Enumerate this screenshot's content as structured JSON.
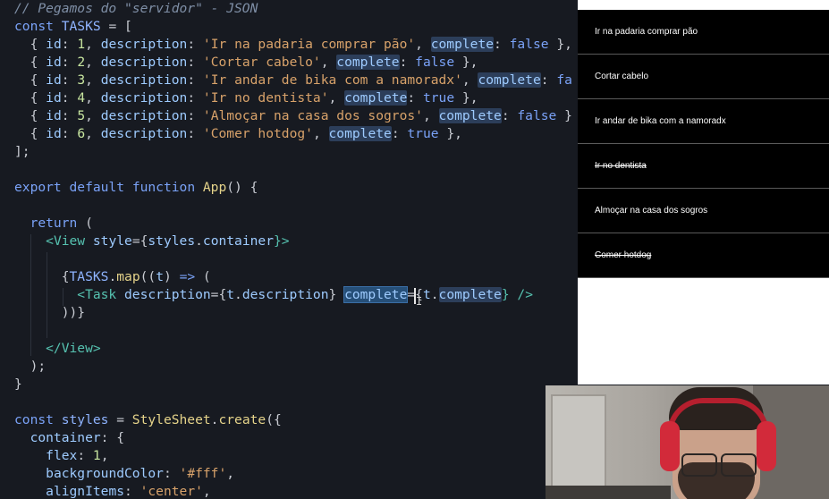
{
  "editor": {
    "lines": [
      [
        [
          "// Pegamos do \"servidor\" - JSON",
          "comment"
        ]
      ],
      [
        [
          "const ",
          "keyword"
        ],
        [
          "TASKS",
          "const"
        ],
        [
          " = [",
          "punct"
        ]
      ],
      [
        [
          "  { ",
          "punct"
        ],
        [
          "id",
          "prop"
        ],
        [
          ": ",
          "punct"
        ],
        [
          "1",
          "num"
        ],
        [
          ", ",
          "punct"
        ],
        [
          "description",
          "prop"
        ],
        [
          ": ",
          "punct"
        ],
        [
          "'Ir na padaria comprar pão'",
          "string"
        ],
        [
          ", ",
          "punct"
        ],
        [
          "complete",
          "hl"
        ],
        [
          ": ",
          "punct"
        ],
        [
          "false",
          "bool"
        ],
        [
          " },",
          "punct"
        ]
      ],
      [
        [
          "  { ",
          "punct"
        ],
        [
          "id",
          "prop"
        ],
        [
          ": ",
          "punct"
        ],
        [
          "2",
          "num"
        ],
        [
          ", ",
          "punct"
        ],
        [
          "description",
          "prop"
        ],
        [
          ": ",
          "punct"
        ],
        [
          "'Cortar cabelo'",
          "string"
        ],
        [
          ", ",
          "punct"
        ],
        [
          "complete",
          "hl"
        ],
        [
          ": ",
          "punct"
        ],
        [
          "false",
          "bool"
        ],
        [
          " },",
          "punct"
        ]
      ],
      [
        [
          "  { ",
          "punct"
        ],
        [
          "id",
          "prop"
        ],
        [
          ": ",
          "punct"
        ],
        [
          "3",
          "num"
        ],
        [
          ", ",
          "punct"
        ],
        [
          "description",
          "prop"
        ],
        [
          ": ",
          "punct"
        ],
        [
          "'Ir andar de bika com a namoradx'",
          "string"
        ],
        [
          ", ",
          "punct"
        ],
        [
          "complete",
          "hl"
        ],
        [
          ": ",
          "punct"
        ],
        [
          "fa",
          "bool"
        ]
      ],
      [
        [
          "  { ",
          "punct"
        ],
        [
          "id",
          "prop"
        ],
        [
          ": ",
          "punct"
        ],
        [
          "4",
          "num"
        ],
        [
          ", ",
          "punct"
        ],
        [
          "description",
          "prop"
        ],
        [
          ": ",
          "punct"
        ],
        [
          "'Ir no dentista'",
          "string"
        ],
        [
          ", ",
          "punct"
        ],
        [
          "complete",
          "hl"
        ],
        [
          ": ",
          "punct"
        ],
        [
          "true",
          "bool"
        ],
        [
          " },",
          "punct"
        ]
      ],
      [
        [
          "  { ",
          "punct"
        ],
        [
          "id",
          "prop"
        ],
        [
          ": ",
          "punct"
        ],
        [
          "5",
          "num"
        ],
        [
          ", ",
          "punct"
        ],
        [
          "description",
          "prop"
        ],
        [
          ": ",
          "punct"
        ],
        [
          "'Almoçar na casa dos sogros'",
          "string"
        ],
        [
          ", ",
          "punct"
        ],
        [
          "complete",
          "hl"
        ],
        [
          ": ",
          "punct"
        ],
        [
          "false",
          "bool"
        ],
        [
          " }",
          "punct"
        ]
      ],
      [
        [
          "  { ",
          "punct"
        ],
        [
          "id",
          "prop"
        ],
        [
          ": ",
          "punct"
        ],
        [
          "6",
          "num"
        ],
        [
          ", ",
          "punct"
        ],
        [
          "description",
          "prop"
        ],
        [
          ": ",
          "punct"
        ],
        [
          "'Comer hotdog'",
          "string"
        ],
        [
          ", ",
          "punct"
        ],
        [
          "complete",
          "hl"
        ],
        [
          ": ",
          "punct"
        ],
        [
          "true",
          "bool"
        ],
        [
          " },",
          "punct"
        ]
      ],
      [
        [
          "];",
          "punct"
        ]
      ],
      [],
      [
        [
          "export ",
          "keyword"
        ],
        [
          "default ",
          "keyword"
        ],
        [
          "function ",
          "keyword"
        ],
        [
          "App",
          "func"
        ],
        [
          "() {",
          "punct"
        ]
      ],
      [],
      [
        [
          "  ",
          "punct"
        ],
        [
          "return",
          "keyword"
        ],
        [
          " (",
          "punct"
        ]
      ],
      [
        [
          "    <",
          "tag"
        ],
        [
          "View",
          "tag"
        ],
        [
          " style",
          "prop"
        ],
        [
          "={",
          "punct"
        ],
        [
          "styles",
          "prop"
        ],
        [
          ".",
          "punct"
        ],
        [
          "container",
          "prop"
        ],
        [
          "}>",
          "tag"
        ]
      ],
      [],
      [
        [
          "      {",
          "punct"
        ],
        [
          "TASKS",
          "const"
        ],
        [
          ".",
          "punct"
        ],
        [
          "map",
          "func"
        ],
        [
          "((",
          "punct"
        ],
        [
          "t",
          "prop"
        ],
        [
          ") ",
          "punct"
        ],
        [
          "=>",
          "keyword"
        ],
        [
          " (",
          "punct"
        ]
      ],
      [
        [
          "        <",
          "tag"
        ],
        [
          "Task",
          "tag"
        ],
        [
          " description",
          "prop"
        ],
        [
          "={",
          "punct"
        ],
        [
          "t",
          "prop"
        ],
        [
          ".",
          "punct"
        ],
        [
          "description",
          "prop"
        ],
        [
          "} ",
          "punct"
        ],
        [
          "complete",
          "sel"
        ],
        [
          "={",
          "punct"
        ],
        [
          "t",
          "prop"
        ],
        [
          ".",
          "punct"
        ],
        [
          "complete",
          "hl"
        ],
        [
          "} />",
          "tag"
        ]
      ],
      [
        [
          "      ))}",
          "punct"
        ]
      ],
      [],
      [
        [
          "    </",
          "tag"
        ],
        [
          "View",
          "tag"
        ],
        [
          ">",
          "tag"
        ]
      ],
      [
        [
          "  );",
          "punct"
        ]
      ],
      [
        [
          "}",
          "punct"
        ]
      ],
      [],
      [
        [
          "const ",
          "keyword"
        ],
        [
          "styles",
          "const"
        ],
        [
          " = ",
          "punct"
        ],
        [
          "StyleSheet",
          "func"
        ],
        [
          ".",
          "punct"
        ],
        [
          "create",
          "func"
        ],
        [
          "({",
          "punct"
        ]
      ],
      [
        [
          "  ",
          "punct"
        ],
        [
          "container",
          "prop"
        ],
        [
          ": {",
          "punct"
        ]
      ],
      [
        [
          "    ",
          "punct"
        ],
        [
          "flex",
          "prop"
        ],
        [
          ": ",
          "punct"
        ],
        [
          "1",
          "num"
        ],
        [
          ",",
          "punct"
        ]
      ],
      [
        [
          "    ",
          "punct"
        ],
        [
          "backgroundColor",
          "prop"
        ],
        [
          ": ",
          "punct"
        ],
        [
          "'#fff'",
          "string"
        ],
        [
          ",",
          "punct"
        ]
      ],
      [
        [
          "    ",
          "punct"
        ],
        [
          "alignItems",
          "prop"
        ],
        [
          ": ",
          "punct"
        ],
        [
          "'center'",
          "string"
        ],
        [
          ",",
          "punct"
        ]
      ]
    ]
  },
  "preview": {
    "tasks": [
      {
        "label": "Ir na padaria comprar pão",
        "complete": false
      },
      {
        "label": "Cortar cabelo",
        "complete": false
      },
      {
        "label": "Ir andar de bika com a namoradx",
        "complete": false
      },
      {
        "label": "Ir no dentista",
        "complete": true
      },
      {
        "label": "Almoçar na casa dos sogros",
        "complete": false
      },
      {
        "label": "Comer hotdog",
        "complete": true
      }
    ]
  },
  "colors": {
    "editor_bg": "#171a21",
    "task_bg": "#000000",
    "task_text": "#ffffff",
    "selection": "#264f78"
  }
}
